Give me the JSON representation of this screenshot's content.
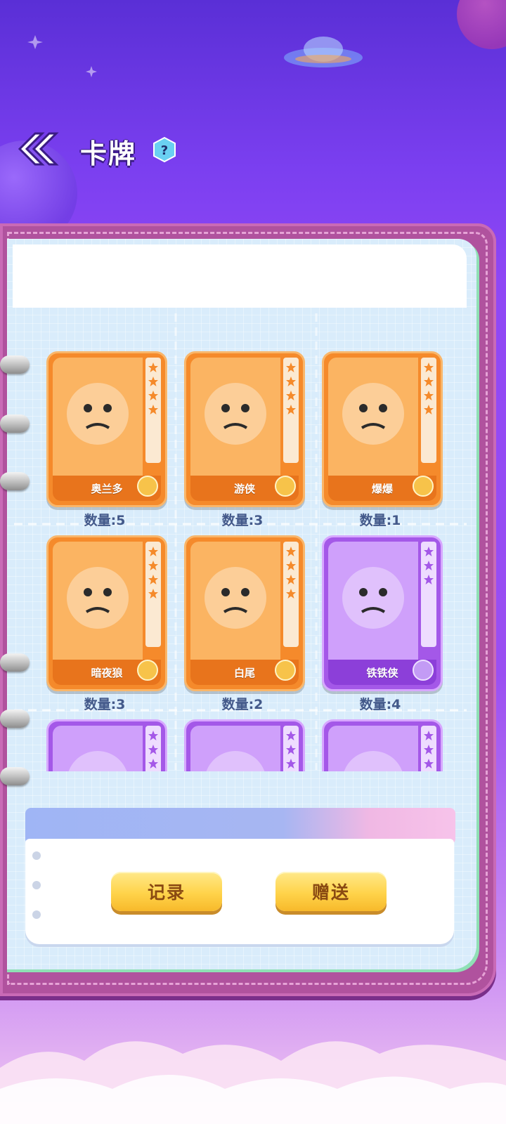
{
  "header": {
    "title": "卡牌",
    "help_symbol": "?"
  },
  "cards": [
    {
      "name": "奥兰多",
      "count_label": "数量:5",
      "rarity": "orange",
      "stars": 4
    },
    {
      "name": "游侠",
      "count_label": "数量:3",
      "rarity": "orange",
      "stars": 4
    },
    {
      "name": "爆爆",
      "count_label": "数量:1",
      "rarity": "orange",
      "stars": 4
    },
    {
      "name": "暗夜狼",
      "count_label": "数量:3",
      "rarity": "orange",
      "stars": 4
    },
    {
      "name": "白尾",
      "count_label": "数量:2",
      "rarity": "orange",
      "stars": 4
    },
    {
      "name": "铁铁侠",
      "count_label": "数量:4",
      "rarity": "purple",
      "stars": 3
    },
    {
      "name": "",
      "count_label": "",
      "rarity": "purple",
      "stars": 3
    },
    {
      "name": "",
      "count_label": "",
      "rarity": "purple",
      "stars": 3
    },
    {
      "name": "",
      "count_label": "",
      "rarity": "purple",
      "stars": 3
    }
  ],
  "footer": {
    "record_label": "记录",
    "gift_label": "赠送"
  },
  "colors": {
    "orange_card": "#f58a2b",
    "purple_card": "#a458e8",
    "button": "#ffd34a",
    "count_text": "#43598a"
  }
}
